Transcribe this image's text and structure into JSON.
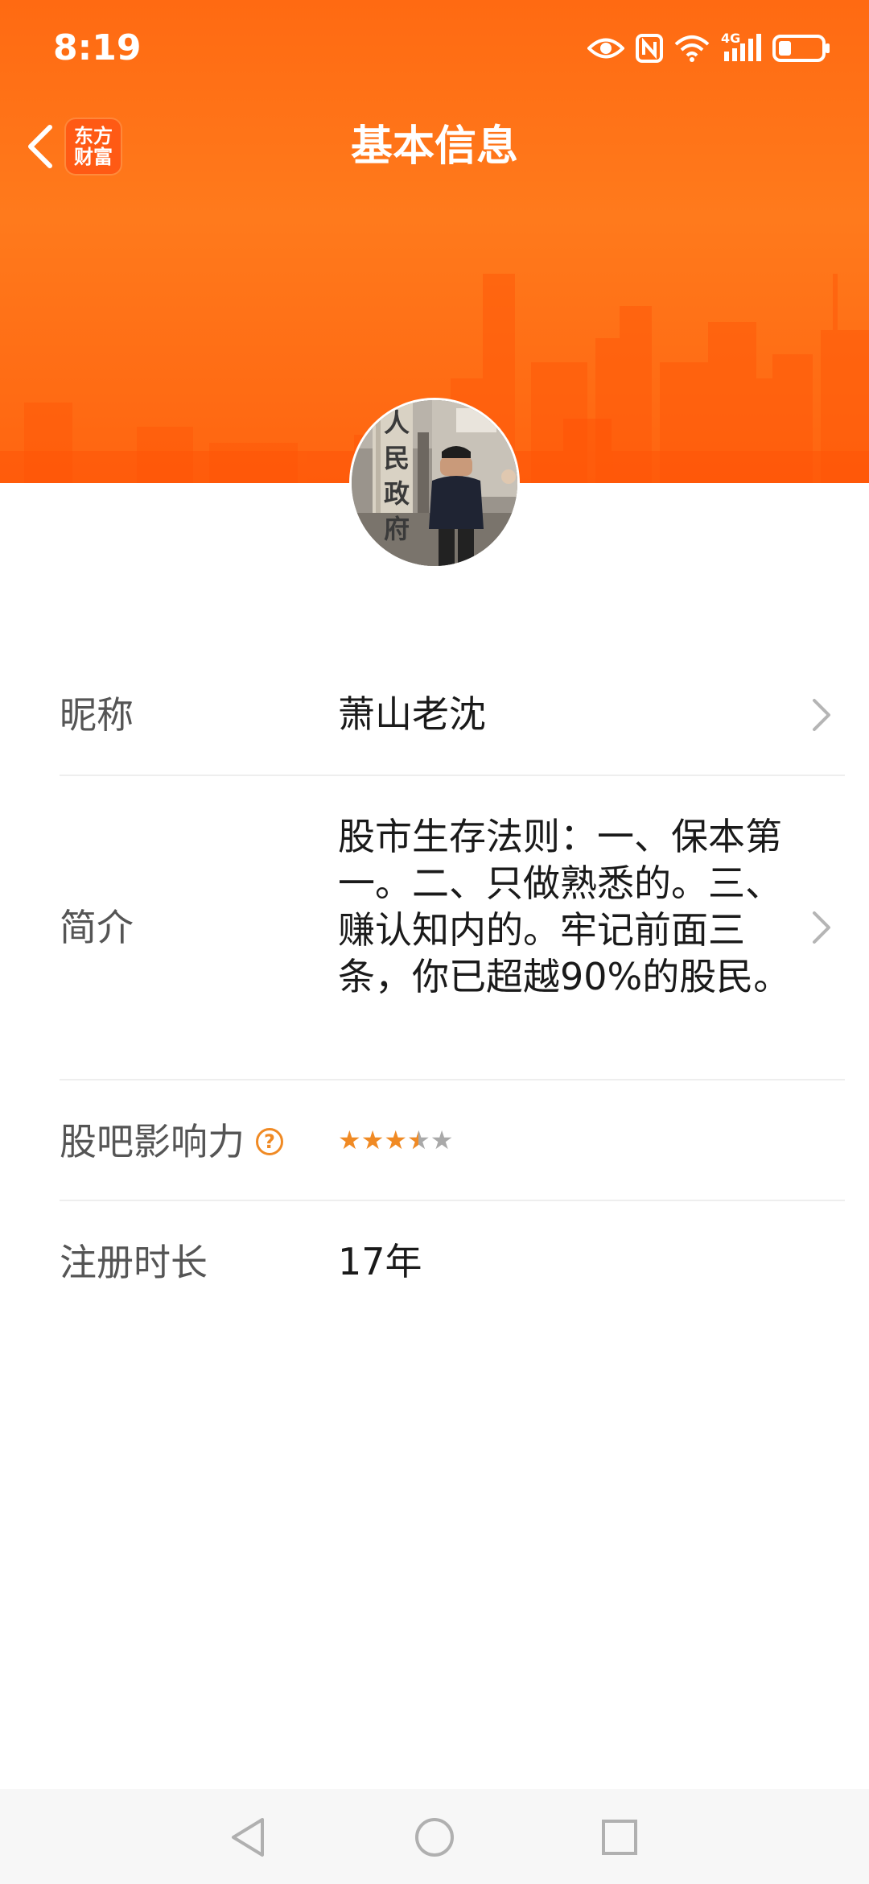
{
  "status_bar": {
    "time": "8:19",
    "network_label": "4G",
    "icons": [
      "eye-icon",
      "nfc-icon",
      "wifi-icon",
      "signal-4g-icon",
      "battery-icon"
    ],
    "battery_percent": 25
  },
  "nav": {
    "back_icon": "chevron-left-icon",
    "logo_line1": "东方",
    "logo_line2": "财富",
    "title": "基本信息"
  },
  "profile": {
    "avatar_sign_text": [
      "人",
      "民",
      "政",
      "府"
    ],
    "rows": [
      {
        "label": "昵称",
        "value": "萧山老沈",
        "has_chevron": true
      },
      {
        "label": "简介",
        "value": "股市生存法则：一、保本第一。二、只做熟悉的。三、赚认知内的。牢记前面三条，你已超越90%的股民。",
        "has_chevron": true
      },
      {
        "label": "股吧影响力",
        "help_icon": "question-circle-icon",
        "rating": 3.5,
        "rating_max": 5
      },
      {
        "label": "注册时长",
        "value": "17年"
      }
    ]
  },
  "colors": {
    "header_orange": "#ff6a12",
    "accent_orange": "#f08a24",
    "label_gray": "#555555",
    "value_black": "#1a1a1a",
    "divider": "#eeeeee"
  },
  "system_nav": {
    "buttons": [
      "back-triangle-icon",
      "home-circle-icon",
      "recents-square-icon"
    ]
  }
}
